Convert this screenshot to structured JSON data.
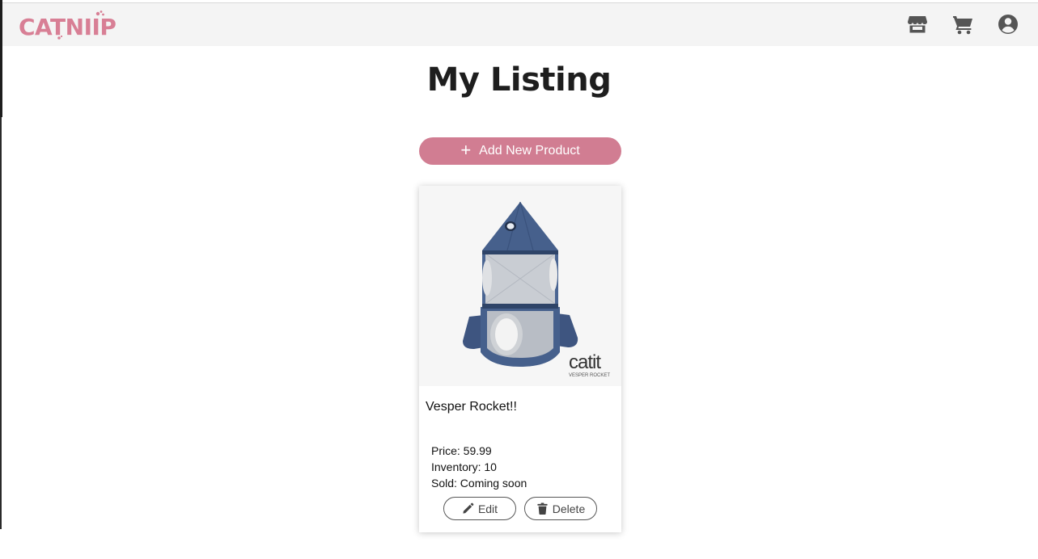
{
  "app": {
    "logo_text": "CATNIIP",
    "brand_color": "#d17d92"
  },
  "nav": {
    "icons": [
      "store-icon",
      "cart-icon",
      "account-icon"
    ]
  },
  "page": {
    "title": "My Listing"
  },
  "actions": {
    "add_product_label": "Add New Product",
    "add_icon": "plus-icon"
  },
  "listings": [
    {
      "name": "Vesper Rocket!!",
      "image_brand": "catit",
      "image_caption": "VESPER ROCKET",
      "price_text": "Price: 59.99",
      "inventory_text": "Inventory: 10",
      "sold_text": "Sold: Coming soon",
      "edit_label": "Edit",
      "delete_label": "Delete"
    }
  ]
}
